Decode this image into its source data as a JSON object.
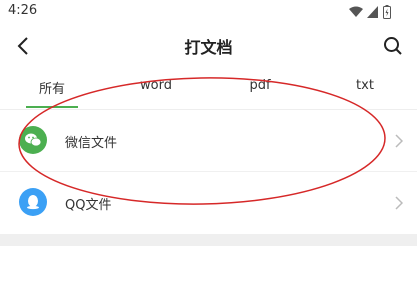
{
  "status_bar": {
    "time": "4:26"
  },
  "header": {
    "title": "打文档"
  },
  "tabs": [
    {
      "label": "所有",
      "selected": true
    },
    {
      "label": "word",
      "selected": false
    },
    {
      "label": "pdf",
      "selected": false
    },
    {
      "label": "txt",
      "selected": false
    }
  ],
  "list": [
    {
      "label": "微信文件",
      "icon": "wechat-icon",
      "icon_color": "#4caf50"
    },
    {
      "label": "QQ文件",
      "icon": "qq-icon",
      "icon_color": "#3ba0f5"
    }
  ],
  "colors": {
    "accent": "#4caf50",
    "annotation": "#d62828"
  }
}
